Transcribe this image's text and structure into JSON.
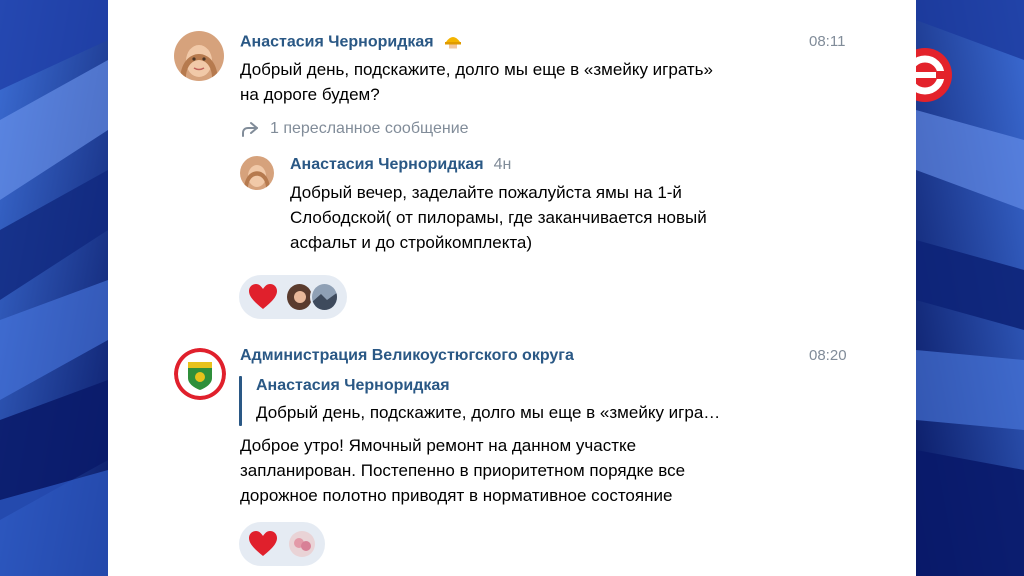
{
  "colors": {
    "author": "#2a5885",
    "time": "#818c99",
    "reaction_bg": "#e5ebf3",
    "heart": "#e0202c",
    "backdrop": "#0b1f6e",
    "logo": "#e3222b"
  },
  "messages": [
    {
      "author": "Анастасия Черноридкая",
      "author_badge_icon": "construction-worker-emoji",
      "time": "08:11",
      "text_lines": [
        "Добрый день, подскажите, долго мы еще в «змейку играть»",
        "на дороге будем?"
      ],
      "forwarded": {
        "icon": "share-arrow-icon",
        "label": "1 пересланное сообщение",
        "author": "Анастасия Черноридкая",
        "time": "4н",
        "text_lines": [
          "Добрый вечер, заделайте пожалуйста ямы на 1-й",
          "Слободской( от пилорамы, где заканчивается новый",
          "асфальт и до стройкомплекта)"
        ]
      },
      "reactions": {
        "icon": "heart-icon"
      }
    },
    {
      "author": "Администрация Великоустюгского округа",
      "time": "08:20",
      "reply": {
        "author": "Анастасия Черноридкая",
        "text": "Добрый день, подскажите, долго мы еще в «змейку игра…"
      },
      "text_lines": [
        "Доброе утро! Ямочный ремонт на данном участке",
        "запланирован. Постепенно в приоритетном порядке все",
        "дорожное полотно приводят в нормативное состояние"
      ],
      "reactions": {
        "icon": "heart-icon"
      }
    }
  ]
}
